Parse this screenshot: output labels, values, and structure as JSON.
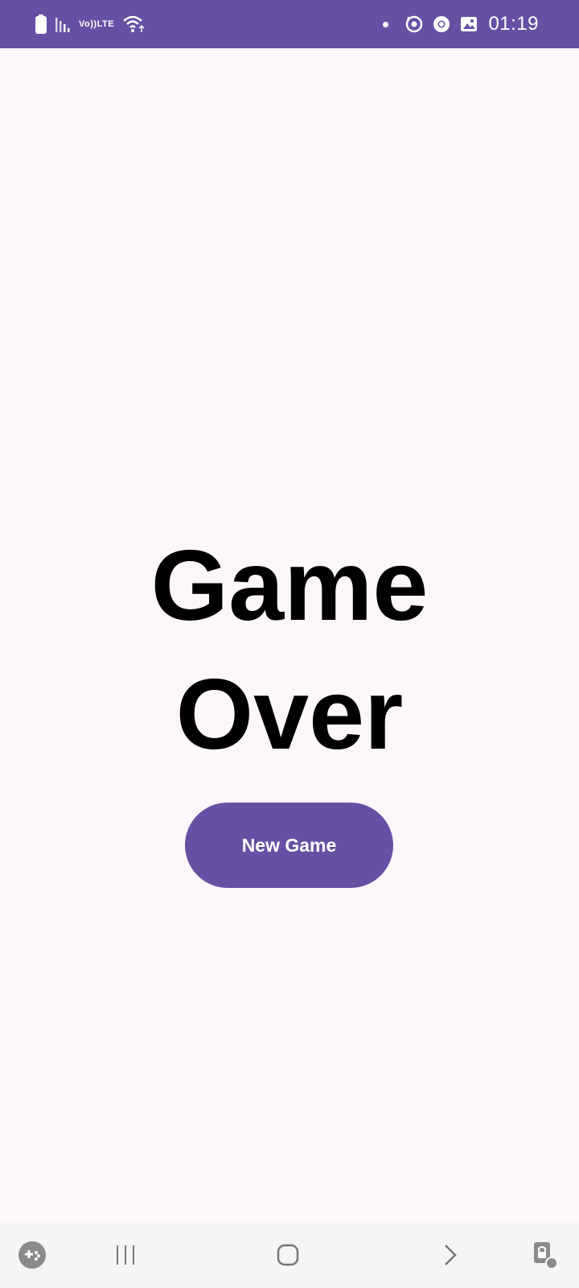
{
  "status_bar": {
    "time": "01:19",
    "network_label_top": "Vo))",
    "network_label_bottom": "LTE",
    "icons_left": [
      "battery-icon",
      "signal-icon",
      "volte-icon",
      "wifi-icon"
    ],
    "icons_right": [
      "notification-dot-icon",
      "sync-icon",
      "chrome-icon",
      "gallery-icon"
    ]
  },
  "game": {
    "title_line1": "Game",
    "title_line2": "Over",
    "new_game_label": "New Game"
  },
  "nav_bar": {
    "items": [
      "game-launcher-icon",
      "recent-apps-icon",
      "home-icon",
      "back-icon",
      "screen-pin-icon"
    ]
  },
  "colors": {
    "accent": "#6750A4",
    "background": "#FDF7FC",
    "text": "#000000",
    "nav_background": "#F5F5F5"
  }
}
